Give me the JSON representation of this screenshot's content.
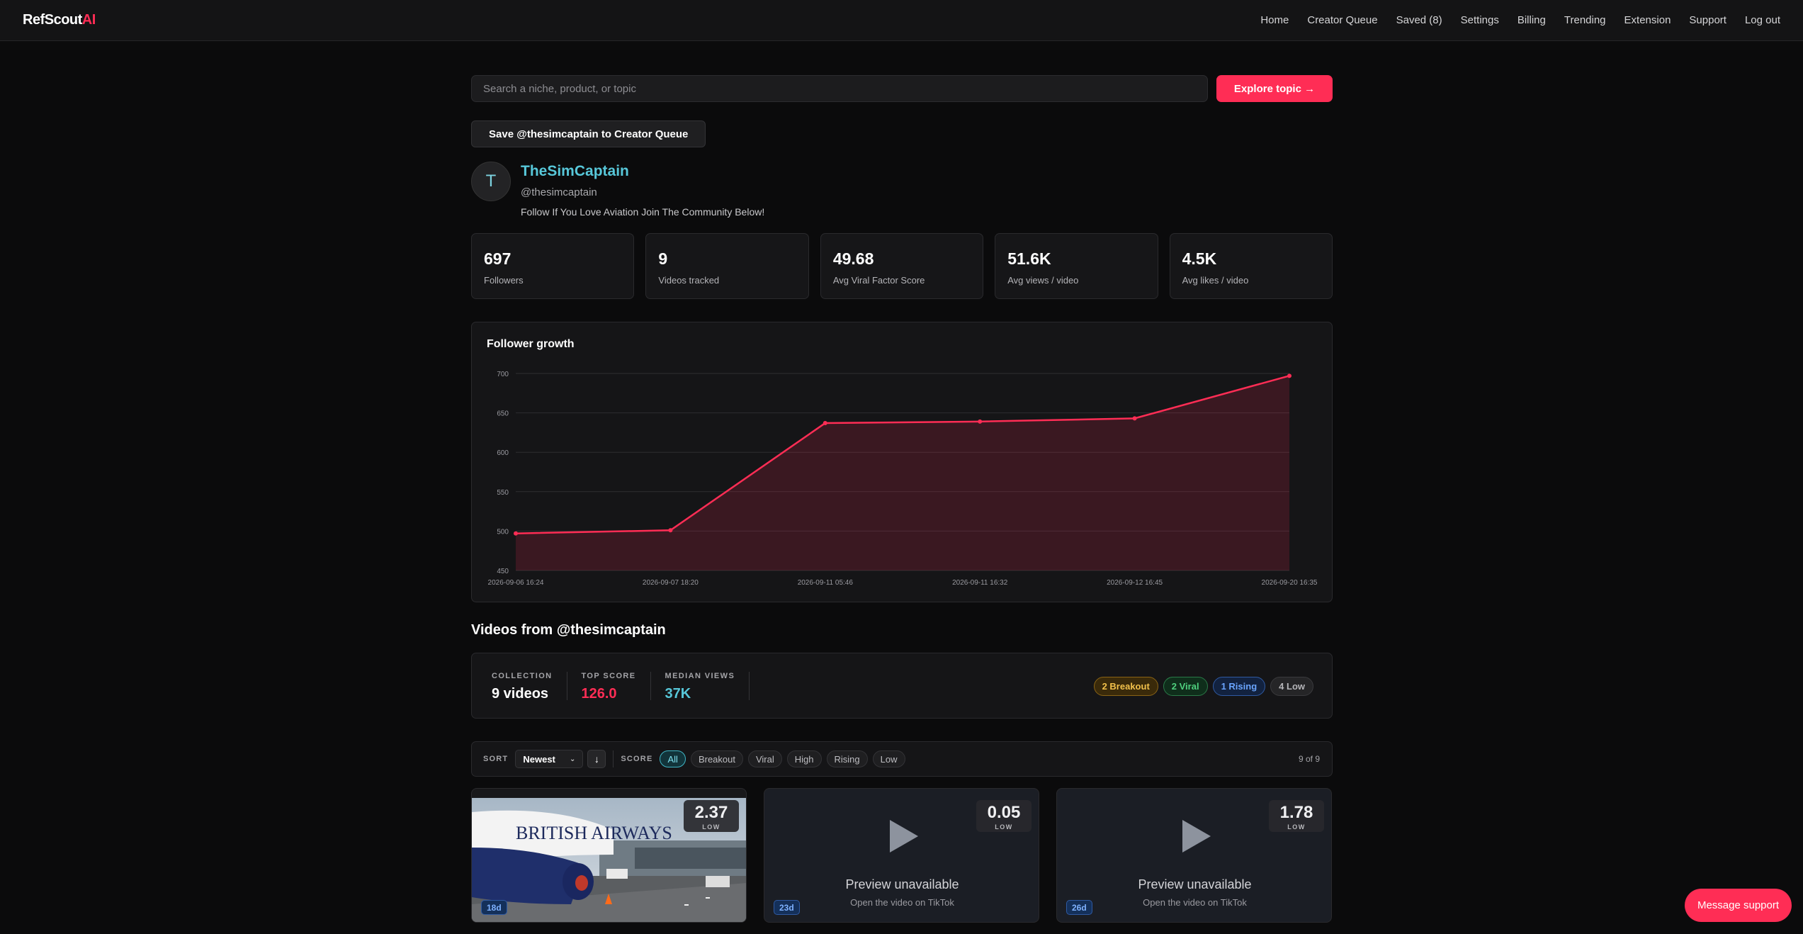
{
  "nav": {
    "logo_main": "RefScout",
    "logo_accent": "AI",
    "links": [
      "Home",
      "Creator Queue",
      "Saved (8)",
      "Settings",
      "Billing",
      "Trending",
      "Extension",
      "Support",
      "Log out"
    ]
  },
  "search": {
    "placeholder": "Search a niche, product, or topic",
    "value": "",
    "button_label": "Explore topic →"
  },
  "save_button_label": "Save @thesimcaptain to Creator Queue",
  "profile": {
    "avatar_letter": "T",
    "name": "TheSimCaptain",
    "handle": "@thesimcaptain",
    "bio": "Follow If You Love Aviation Join The Community Below!"
  },
  "stats": [
    {
      "value": "697",
      "label": "Followers"
    },
    {
      "value": "9",
      "label": "Videos tracked"
    },
    {
      "value": "49.68",
      "label": "Avg Viral Factor Score"
    },
    {
      "value": "51.6K",
      "label": "Avg views / video"
    },
    {
      "value": "4.5K",
      "label": "Avg likes / video"
    }
  ],
  "chart_data": {
    "type": "area",
    "title": "Follower growth",
    "x": [
      "2026-09-06 16:24",
      "2026-09-07 18:20",
      "2026-09-11 05:46",
      "2026-09-11 16:32",
      "2026-09-12 16:45",
      "2026-09-20 16:35"
    ],
    "values": [
      497,
      501,
      637,
      639,
      643,
      697
    ],
    "ylim": [
      450,
      700
    ],
    "yticks": [
      450,
      500,
      550,
      600,
      650,
      700
    ],
    "grid": true,
    "line_color": "#ff2d55"
  },
  "videos_title": "Videos from @thesimcaptain",
  "collection": {
    "metrics": [
      {
        "key": "COLLECTION",
        "value": "9 videos",
        "color": "#ffffff"
      },
      {
        "key": "TOP SCORE",
        "value": "126.0",
        "color": "#ff2d55"
      },
      {
        "key": "MEDIAN VIEWS",
        "value": "37K",
        "color": "#57c7d9"
      }
    ],
    "badges": [
      {
        "label": "2 Breakout",
        "kind": "breakout"
      },
      {
        "label": "2 Viral",
        "kind": "viral"
      },
      {
        "label": "1 Rising",
        "kind": "rising"
      },
      {
        "label": "4 Low",
        "kind": "low"
      }
    ]
  },
  "filters": {
    "sort_label": "SORT",
    "sort_value": "Newest",
    "score_label": "SCORE",
    "chips": [
      "All",
      "Breakout",
      "Viral",
      "High",
      "Rising",
      "Low"
    ],
    "active_chip": "All",
    "count": "9 of 9"
  },
  "videos": [
    {
      "score": "2.37",
      "tier": "LOW",
      "age": "18d",
      "preview": true
    },
    {
      "score": "0.05",
      "tier": "LOW",
      "age": "23d",
      "preview": false,
      "unavailable": "Preview unavailable",
      "hint": "Open the video on TikTok"
    },
    {
      "score": "1.78",
      "tier": "LOW",
      "age": "26d",
      "preview": false,
      "unavailable": "Preview unavailable",
      "hint": "Open the video on TikTok"
    }
  ],
  "support_button_label": "Message support"
}
